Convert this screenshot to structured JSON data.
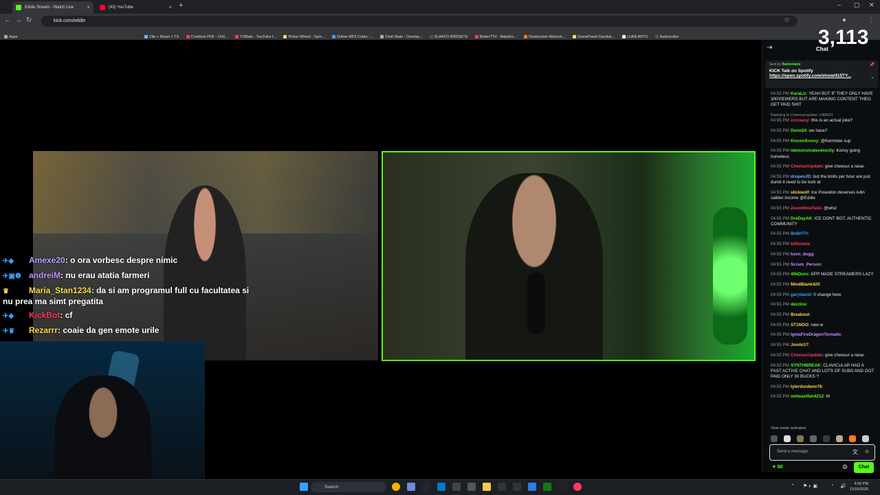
{
  "browser": {
    "tabs": [
      {
        "label": "Eddie Stream - Watch Live",
        "favicon_color": "#53fc18",
        "active": true
      },
      {
        "label": "(43) YouTube",
        "favicon_color": "#ff0033",
        "active": false
      }
    ],
    "url": "kick.com/eddie",
    "bookmarks": [
      "Apps",
      "Vite + React + TS",
      "Combine PDF - Onli...",
      "Y2Mate - YouTube t...",
      "Picker Wheel - Spin...",
      "Online MP3 Cutter -...",
      "Chat Stats - Overlay...",
      "SLAAYO WIDGETS",
      "BetterTTV - BabyKo...",
      "Destruction Warlock...",
      "GamePanel Gazduir...",
      "LUAR ARTS",
      "Audiocutter"
    ]
  },
  "overlay_chat": [
    {
      "user": "Amexe20",
      "text": "o ora vorbesc despre nimic",
      "color": "#b4a0ff"
    },
    {
      "user": "andreiM",
      "text": "nu erau atatia farmeri",
      "color": "#c88cff"
    },
    {
      "user": "Maria_Stan1234",
      "text": "da si am programul full cu facultatea si nu prea ma simt pregatita",
      "color": "#ffd84a"
    },
    {
      "user": "KickBot",
      "text": "cf",
      "color": "#ff3b5c"
    },
    {
      "user": "Rezarrr",
      "text": "coaie da gen emote urile",
      "color": "#ffd84a"
    }
  ],
  "chat": {
    "title": "Chat",
    "viewer_count": "3,113",
    "pinned": {
      "sent_by_label": "Sent by",
      "sender": "Bantemarie",
      "title": "KICK Talk on Spotify",
      "link": "https://open.spotify.com/show/415TY..."
    },
    "messages": [
      {
        "ts": "04:55 PM",
        "user": "KaraLiz",
        "color": "#53fc18",
        "text": "YEAH BUT IF THEY ONLY HAVE 300VIEWERS BUT ARE MAKING CONTENT THEG GET PAID SHIT"
      },
      {
        "ts": "04:55 PM",
        "user": "zxrceasy",
        "color": "#ff3b5c",
        "text": "this is an actual joke?",
        "reply": "Replying to CheesurUpdate: LMAOO"
      },
      {
        "ts": "04:55 PM",
        "user": "Donn24",
        "color": "#53fc18",
        "text": "we have?"
      },
      {
        "ts": "04:55 PM",
        "user": "KnoxicKnoxy",
        "color": "#53fc18",
        "text": "@Kerrmiee sup"
      },
      {
        "ts": "04:55 PM",
        "user": "idemonstrateveiocity",
        "color": "#53fc18",
        "text": "Konvy going homeless"
      },
      {
        "ts": "04:55 PM",
        "user": "CheesurUpdate",
        "color": "#ff3b5c",
        "text": "give cheesur a raise."
      },
      {
        "ts": "04:55 PM",
        "user": "dropenJD",
        "color": "#7fb0ff",
        "text": "but the limits per hour are just dumb it need to be look at"
      },
      {
        "ts": "04:55 PM",
        "user": "slickwolf",
        "color": "#ffd84a",
        "text": "Ice Poseidon deserves Adin caliber income @Eddie"
      },
      {
        "ts": "04:55 PM",
        "user": "ZoomNineTails",
        "color": "#ff3b5c",
        "text": "@whiz"
      },
      {
        "ts": "04:55 PM",
        "user": "DreDayAK",
        "color": "#53fc18",
        "text": "ICE DONT BOT, AUTHENTIC COMMUNITY"
      },
      {
        "ts": "04:55 PM",
        "user": "BnBrITV",
        "color": "#3aa0ff",
        "text": ""
      },
      {
        "ts": "04:55 PM",
        "user": "billistaria",
        "color": "#ff3b5c",
        "text": ""
      },
      {
        "ts": "04:55 PM",
        "user": "kevn_dogg",
        "color": "#c88cff",
        "text": ""
      },
      {
        "ts": "04:55 PM",
        "user": "Scram_Person",
        "color": "#c88cff",
        "text": ""
      },
      {
        "ts": "04:55 PM",
        "user": "40kDunc",
        "color": "#53fc18",
        "text": "KPP MADE STREAMERS LAZY"
      },
      {
        "ts": "04:55 PM",
        "user": "MindBlank420",
        "color": "#ffd84a",
        "text": ""
      },
      {
        "ts": "04:55 PM",
        "user": "garydavid",
        "color": "#3aa0ff",
        "text": "0 change here"
      },
      {
        "ts": "04:55 PM",
        "user": "dezzino",
        "color": "#53fc18",
        "text": ""
      },
      {
        "ts": "04:55 PM",
        "user": "Breakout",
        "color": "#ffd84a",
        "text": ""
      },
      {
        "ts": "04:55 PM",
        "user": "ST1NOO",
        "color": "#ffd84a",
        "text": "naw w"
      },
      {
        "ts": "04:55 PM",
        "user": "IgniaFireDragonTornado",
        "color": "#c88cff",
        "text": ""
      },
      {
        "ts": "04:55 PM",
        "user": "Jondo17",
        "color": "#ffd84a",
        "text": ""
      },
      {
        "ts": "04:55 PM",
        "user": "CheesurUpdate",
        "color": "#ff3b5c",
        "text": "give cheesur a raise."
      },
      {
        "ts": "04:55 PM",
        "user": "SYNTHBREAK",
        "color": "#53fc18",
        "text": "CLAVICULAR HAD A FAST ACTIVE CHAT AND LOTS OF SUBS AND GOT PAID ONLY 30 BUCKS ?"
      },
      {
        "ts": "04:55 PM",
        "user": "tylerdurdenn76",
        "color": "#ffd84a",
        "text": ""
      },
      {
        "ts": "04:55 PM",
        "user": "mrbeastfan4212",
        "color": "#53fc18",
        "text": "W"
      }
    ],
    "slow_mode": "Slow mode activated",
    "input_placeholder": "Send a message",
    "points": "80",
    "send_label": "Chat"
  },
  "taskbar": {
    "search_label": "Search",
    "time": "4:55 PM",
    "date": "11/15/2025"
  }
}
